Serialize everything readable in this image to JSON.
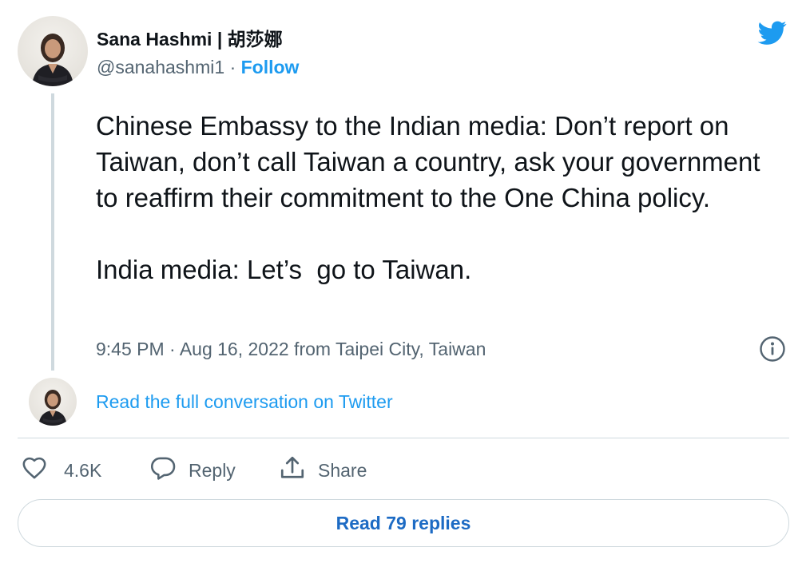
{
  "author": {
    "name": "Sana Hashmi | 胡莎娜",
    "handle": "@sanahashmi1",
    "separator": "·",
    "follow_label": "Follow"
  },
  "tweet": {
    "text": "Chinese Embassy to the Indian media: Don’t report on Taiwan, don’t call Taiwan a country, ask your government to reaffirm their commitment to the One China policy.\n\nIndia media: Let’s  go to Taiwan.",
    "timestamp": "9:45 PM · Aug 16, 2022 from Taipei City, Taiwan"
  },
  "conversation": {
    "read_full_label": "Read the full conversation on Twitter"
  },
  "actions": {
    "like_count": "4.6K",
    "reply_label": "Reply",
    "share_label": "Share"
  },
  "footer": {
    "read_replies_label": "Read 79 replies"
  },
  "icons": {
    "brand": "twitter-bird-icon",
    "info": "info-icon",
    "like": "heart-icon",
    "reply": "speech-bubble-icon",
    "share": "share-upload-icon"
  },
  "colors": {
    "accent": "#1d9bf0",
    "text": "#0f1419",
    "secondary": "#536471",
    "border": "#cfd9de"
  }
}
